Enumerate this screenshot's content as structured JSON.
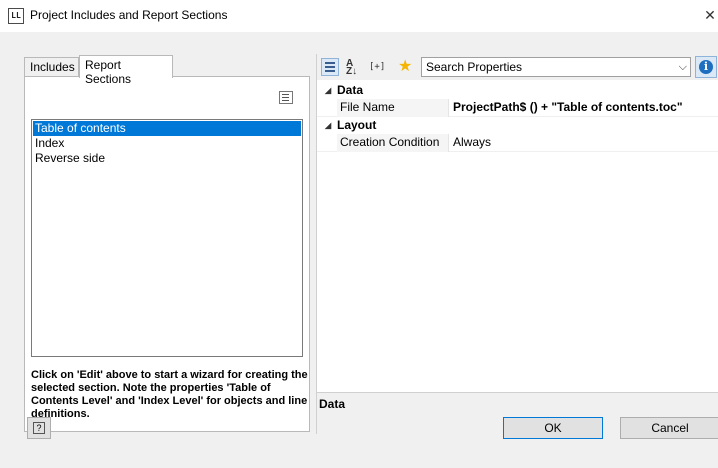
{
  "window": {
    "app_icon": "LL",
    "title": "Project Includes and Report Sections",
    "close_glyph": "✕"
  },
  "tabs": [
    {
      "label": "Includes",
      "active": false
    },
    {
      "label": "Report Sections",
      "active": true
    }
  ],
  "sections": {
    "items": [
      "Table of contents",
      "Index",
      "Reverse side"
    ],
    "selected_index": 0,
    "help_text": "Click on 'Edit' above to start a wizard for creating the selected section. Note the properties 'Table of Contents Level' and 'Index Level' for objects and line definitions."
  },
  "properties": {
    "toolbar": {
      "categorized_icon": "categorized-view-icon",
      "sort_icon": "sort-az-icon",
      "sort_label_top": "A",
      "sort_label_bottom": "Z↓",
      "expand_label": "[+]",
      "favorites_icon": "star-icon",
      "search_placeholder": "Search Properties",
      "info_label": "i"
    },
    "categories": [
      {
        "name": "Data",
        "toggle": "◢",
        "rows": [
          {
            "name": "File Name",
            "value": "ProjectPath$ () + \"Table of contents.toc\"",
            "bold": true
          }
        ]
      },
      {
        "name": "Layout",
        "toggle": "◢",
        "rows": [
          {
            "name": "Creation Condition",
            "value": "Always",
            "bold": false
          }
        ]
      }
    ],
    "description_title": "Data"
  },
  "buttons": {
    "help": "?",
    "ok": "OK",
    "cancel": "Cancel"
  },
  "colors": {
    "selection": "#0078d7",
    "dialog_bg": "#f0f0f0",
    "star": "#f5b400",
    "info": "#1e6fbf"
  }
}
